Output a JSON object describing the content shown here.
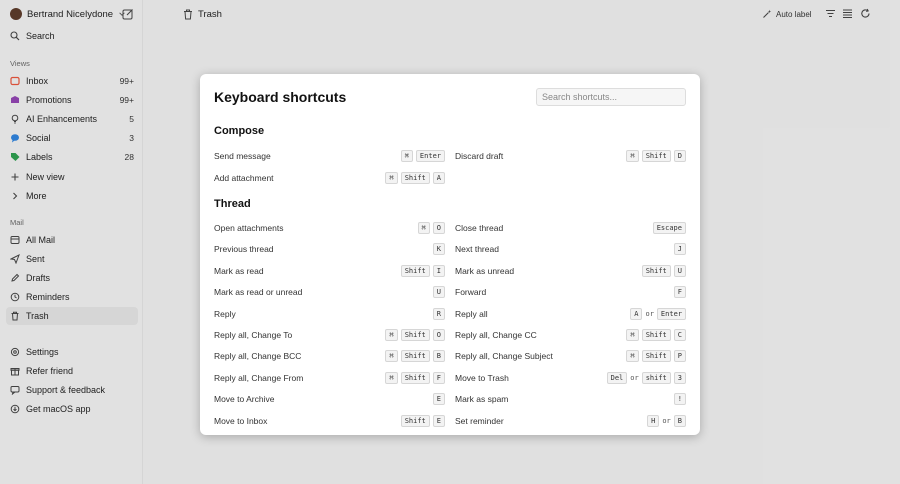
{
  "account": {
    "name": "Bertrand Nicelydone"
  },
  "sidebar": {
    "search_label": "Search",
    "views_header": "Views",
    "views": [
      {
        "label": "Inbox",
        "count": "99+",
        "color": "#e0533b"
      },
      {
        "label": "Promotions",
        "count": "99+",
        "color": "#8e44ad"
      },
      {
        "label": "AI Enhancements",
        "count": "5",
        "color": "#444444"
      },
      {
        "label": "Social",
        "count": "3",
        "color": "#2f7fd6"
      },
      {
        "label": "Labels",
        "count": "28",
        "color": "#2e9a4e"
      }
    ],
    "new_view": "New view",
    "more": "More",
    "mail_header": "Mail",
    "mail": [
      {
        "label": "All Mail"
      },
      {
        "label": "Sent"
      },
      {
        "label": "Drafts"
      },
      {
        "label": "Reminders"
      },
      {
        "label": "Trash"
      }
    ],
    "footer": [
      {
        "label": "Settings"
      },
      {
        "label": "Refer friend"
      },
      {
        "label": "Support & feedback"
      },
      {
        "label": "Get macOS app"
      }
    ]
  },
  "topbar": {
    "title": "Trash",
    "auto_label": "Auto label"
  },
  "modal": {
    "title": "Keyboard shortcuts",
    "search_placeholder": "Search shortcuts...",
    "compose_header": "Compose",
    "thread_header": "Thread",
    "compose": [
      {
        "label": "Send message",
        "keys": [
          "⌘",
          "Enter"
        ]
      },
      {
        "label": "Discard draft",
        "keys": [
          "⌘",
          "Shift",
          "D"
        ]
      },
      {
        "label": "Add attachment",
        "keys": [
          "⌘",
          "Shift",
          "A"
        ]
      }
    ],
    "thread": [
      {
        "label": "Open attachments",
        "keys": [
          "⌘",
          "O"
        ]
      },
      {
        "label": "Close thread",
        "keys": [
          "Escape"
        ]
      },
      {
        "label": "Previous thread",
        "keys": [
          "K"
        ]
      },
      {
        "label": "Next thread",
        "keys": [
          "J"
        ]
      },
      {
        "label": "Mark as read",
        "keys": [
          "Shift",
          "I"
        ]
      },
      {
        "label": "Mark as unread",
        "keys": [
          "Shift",
          "U"
        ]
      },
      {
        "label": "Mark as read or unread",
        "keys": [
          "U"
        ]
      },
      {
        "label": "Forward",
        "keys": [
          "F"
        ]
      },
      {
        "label": "Reply",
        "keys": [
          "R"
        ]
      },
      {
        "label": "Reply all",
        "keys": [
          "A",
          "or",
          "Enter"
        ]
      },
      {
        "label": "Reply all, Change To",
        "keys": [
          "⌘",
          "Shift",
          "O"
        ]
      },
      {
        "label": "Reply all, Change CC",
        "keys": [
          "⌘",
          "Shift",
          "C"
        ]
      },
      {
        "label": "Reply all, Change BCC",
        "keys": [
          "⌘",
          "Shift",
          "B"
        ]
      },
      {
        "label": "Reply all, Change Subject",
        "keys": [
          "⌘",
          "Shift",
          "P"
        ]
      },
      {
        "label": "Reply all, Change From",
        "keys": [
          "⌘",
          "Shift",
          "F"
        ]
      },
      {
        "label": "Move to Trash",
        "keys": [
          "Del",
          "or",
          "shift",
          "3"
        ]
      },
      {
        "label": "Move to Archive",
        "keys": [
          "E"
        ]
      },
      {
        "label": "Mark as spam",
        "keys": [
          "!"
        ]
      },
      {
        "label": "Move to Inbox",
        "keys": [
          "Shift",
          "E"
        ]
      },
      {
        "label": "Set reminder",
        "keys": [
          "H",
          "or",
          "B"
        ]
      }
    ]
  }
}
